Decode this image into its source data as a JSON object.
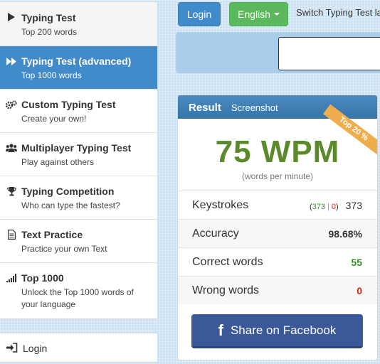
{
  "sidebar": {
    "items": [
      {
        "title": "Typing Test",
        "sub": "Top 200 words",
        "icon": "play-icon"
      },
      {
        "title": "Typing Test (advanced)",
        "sub": "Top 1000 words",
        "icon": "fast-forward-icon"
      },
      {
        "title": "Custom Typing Test",
        "sub": "Create your own!",
        "icon": "gears-icon"
      },
      {
        "title": "Multiplayer Typing Test",
        "sub": "Play against others",
        "icon": "users-icon"
      },
      {
        "title": "Typing Competition",
        "sub": "Who can type the fastest?",
        "icon": "trophy-icon"
      },
      {
        "title": "Text Practice",
        "sub": "Practice your own Text",
        "icon": "document-icon"
      },
      {
        "title": "Top 1000",
        "sub": "Unlock the Top 1000 words of your language",
        "icon": "signal-bars-icon"
      }
    ],
    "login": {
      "label": "Login",
      "icon": "login-icon"
    }
  },
  "header": {
    "login_label": "Login",
    "language_label": "English",
    "switch_text": "Switch Typing Test la"
  },
  "result": {
    "title": "Result",
    "screenshot_label": "Screenshot",
    "ribbon": "Top 20 %",
    "wpm": "75 WPM",
    "wpm_sub": "(words per minute)",
    "keystrokes": {
      "label": "Keystrokes",
      "correct": "373",
      "wrong": "0",
      "separator": "|",
      "total": "373"
    },
    "accuracy": {
      "label": "Accuracy",
      "value": "98.68%"
    },
    "correct_words": {
      "label": "Correct words",
      "value": "55"
    },
    "wrong_words": {
      "label": "Wrong words",
      "value": "0"
    },
    "share_label": "Share on Facebook",
    "share_icon": "f"
  },
  "colors": {
    "primary": "#428bca",
    "success": "#5cb85c",
    "wpm_green": "#5b8a2a",
    "ribbon": "#f0ad4e",
    "facebook": "#3b5998",
    "error": "#d9251d"
  }
}
